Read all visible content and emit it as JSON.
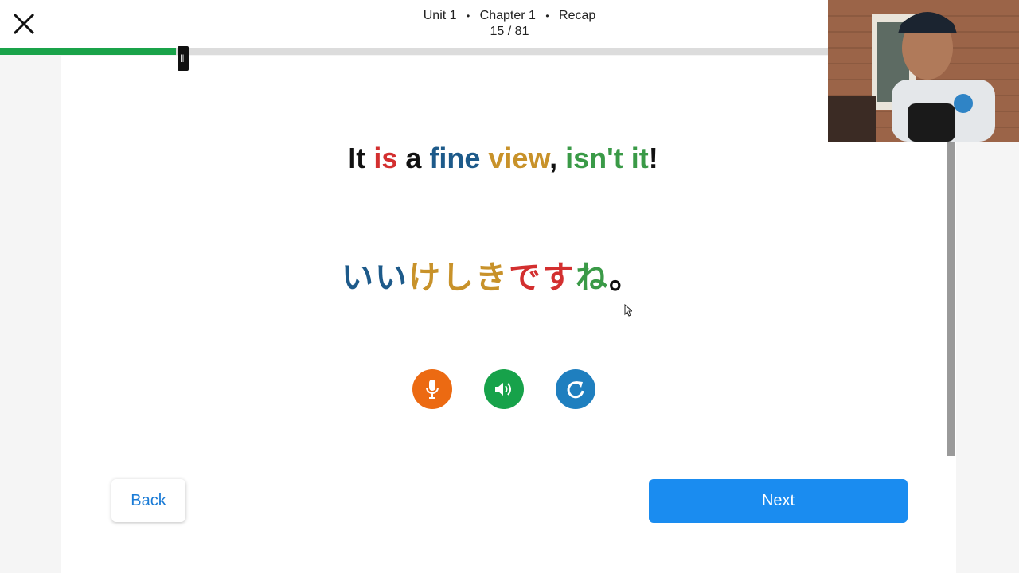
{
  "header": {
    "unit": "Unit 1",
    "chapter": "Chapter 1",
    "section": "Recap",
    "separator": "•",
    "progress_label": "15 / 81"
  },
  "progress": {
    "current": 15,
    "total": 81,
    "fraction": 0.185
  },
  "lesson": {
    "english": [
      {
        "text": "It",
        "color": "#111111"
      },
      {
        "text": " ",
        "color": "#111111"
      },
      {
        "text": "is",
        "color": "#d32f2f"
      },
      {
        "text": " a ",
        "color": "#111111"
      },
      {
        "text": "fine",
        "color": "#1d5a8a"
      },
      {
        "text": " ",
        "color": "#111111"
      },
      {
        "text": "view",
        "color": "#c8922a"
      },
      {
        "text": ", ",
        "color": "#111111"
      },
      {
        "text": "isn't it",
        "color": "#3a9a47"
      },
      {
        "text": "!",
        "color": "#111111"
      }
    ],
    "japanese": [
      {
        "text": "いい",
        "color": "#1d5a8a"
      },
      {
        "text": "けしき",
        "color": "#c8922a"
      },
      {
        "text": "です",
        "color": "#d32f2f"
      },
      {
        "text": "ね",
        "color": "#3a9a47"
      },
      {
        "text": "。",
        "color": "#111111"
      }
    ]
  },
  "controls": {
    "record": {
      "icon": "microphone-icon",
      "color": "#ec6a12"
    },
    "play": {
      "icon": "speaker-icon",
      "color": "#17a24a"
    },
    "replay": {
      "icon": "refresh-icon",
      "color": "#1f7fbf"
    }
  },
  "nav": {
    "back_label": "Back",
    "next_label": "Next"
  },
  "colors": {
    "next_button": "#1a8cf0",
    "back_text": "#1a7bd6",
    "progress_fill": "#1aa34a"
  }
}
